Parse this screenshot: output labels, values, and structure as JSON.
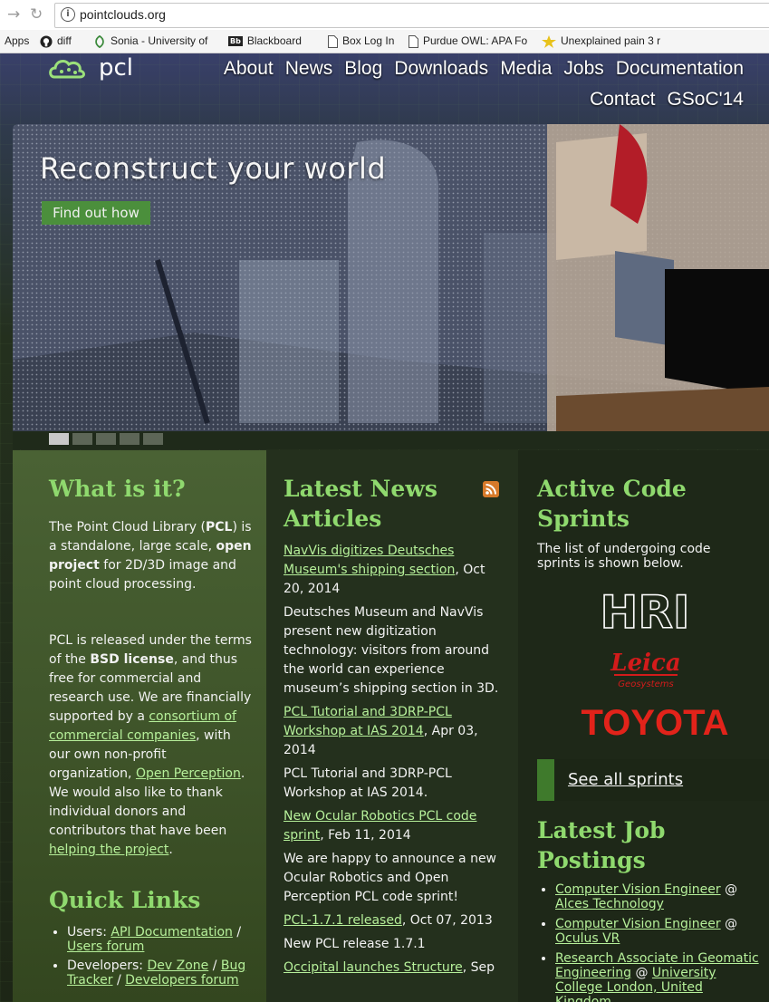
{
  "browser": {
    "url": "pointclouds.org",
    "bookmarks": [
      {
        "label": "Apps"
      },
      {
        "label": "diff"
      },
      {
        "label": "Sonia - University of"
      },
      {
        "label": "Blackboard"
      },
      {
        "label": "Box Log In"
      },
      {
        "label": "Purdue OWL: APA Fo"
      },
      {
        "label": "Unexplained pain 3 r"
      }
    ]
  },
  "site": {
    "logo_text": "pcl",
    "nav": [
      "About",
      "News",
      "Blog",
      "Downloads",
      "Media",
      "Jobs",
      "Documentation",
      "Contact",
      "GSoC'14"
    ]
  },
  "hero": {
    "title": "Reconstruct your world",
    "button": "Find out how",
    "slide_count": 5,
    "active_slide": 1
  },
  "what": {
    "heading": "What is it?",
    "p1_a": "The Point Cloud Library (",
    "p1_b": "PCL",
    "p1_c": ") is a standalone, large scale, ",
    "p1_d": "open project",
    "p1_e": " for 2D/3D image and point cloud processing.",
    "p2_a": "PCL is released under the terms of the ",
    "p2_b": "BSD license",
    "p2_c": ", and thus free for commercial and research use. We are financially supported by a ",
    "p2_link1": "consortium of commercial companies",
    "p2_d": ", with our own non-profit organization, ",
    "p2_link2": "Open Perception",
    "p2_e": ". We would also like to thank individual donors and contributors that have been ",
    "p2_link3": "helping the project",
    "p2_f": "."
  },
  "quick": {
    "heading": "Quick Links",
    "users_label": "Users: ",
    "users_link1": "API Documentation",
    "sep": " / ",
    "users_link2": "Users forum",
    "dev_label": "Developers: ",
    "dev_link1": "Dev Zone",
    "dev_link2": "Bug Tracker",
    "dev_link3": "Developers forum"
  },
  "news": {
    "heading": "Latest News Articles",
    "items": [
      {
        "title": "NavVis digitizes Deutsches Museum's shipping section",
        "date": ", Oct 20, 2014",
        "body": "Deutsches Museum and NavVis present new digitization technology: visitors from around the world can experience museum’s shipping section in 3D."
      },
      {
        "title": "PCL Tutorial and 3DRP-PCL Workshop at IAS 2014",
        "date": ", Apr 03, 2014",
        "body": "PCL Tutorial and 3DRP-PCL Workshop at IAS 2014."
      },
      {
        "title": "New Ocular Robotics PCL code sprint",
        "date": ", Feb 11, 2014",
        "body": "We are happy to announce a new Ocular Robotics and Open Perception PCL code sprint!"
      },
      {
        "title": "PCL-1.7.1 released",
        "date": ", Oct 07, 2013",
        "body": "New PCL release 1.7.1"
      },
      {
        "title": "Occipital launches Structure",
        "date": ", Sep",
        "body": ""
      }
    ]
  },
  "sprints": {
    "heading": "Active Code Sprints",
    "intro": "The list of undergoing code sprints is shown below.",
    "logos": [
      "HRI",
      "Leica",
      "Geosystems",
      "TOYOTA"
    ],
    "button": "See all sprints"
  },
  "jobs": {
    "heading": "Latest Job Postings",
    "items": [
      {
        "title": "Computer Vision Engineer",
        "at": " @ ",
        "company": "Alces Technology"
      },
      {
        "title": "Computer Vision Engineer",
        "at": " @ ",
        "company": "Oculus VR"
      },
      {
        "title": "Research Associate in Geomatic Engineering",
        "at": " @ ",
        "company": "University College London, United Kingdom"
      }
    ]
  },
  "colors": {
    "heading": "#8fd96e",
    "link": "#b6f09a",
    "button_green": "#4b8f3c",
    "toyota_red": "#e2231a",
    "leica_red": "#d21b1b"
  }
}
